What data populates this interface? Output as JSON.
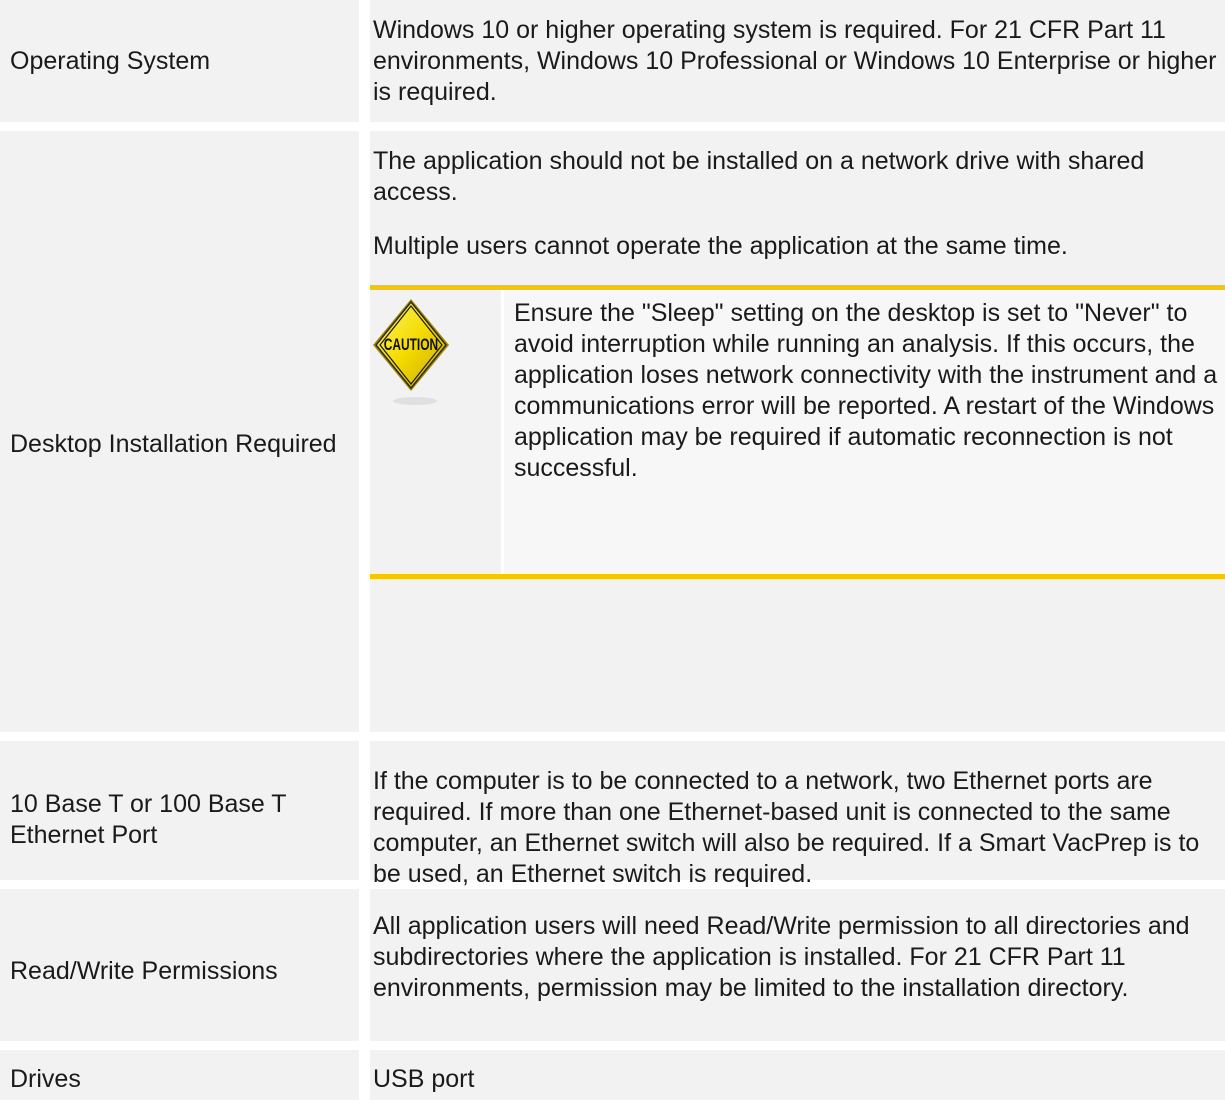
{
  "rows": [
    {
      "label": "Operating System",
      "value": "Windows 10 or higher operating system is required. For 21 CFR Part 11 environments, Windows 10 Professional or Windows 10 Enterprise or higher is required."
    },
    {
      "label": "Desktop Installation Required",
      "paragraphs": [
        "The application should not be installed on a network drive with shared access.",
        "Multiple users cannot operate the application at the same time."
      ],
      "caution": {
        "icon_text": "CAUTION",
        "icon": "caution-sign-icon",
        "text": "Ensure the \"Sleep\" setting on the desktop is set to \"Never\" to avoid interruption while running an analysis. If this occurs, the application loses network connectivity with the instrument and a communications error will be reported. A restart of the Windows application may be required if automatic reconnection is not successful."
      }
    },
    {
      "label": "10 Base T or 100 Base T Ethernet Port",
      "value": "If the computer is to be connected to a network, two Ethernet ports are required. If more than one Ethernet-based unit is connected to the same computer, an Ethernet switch will also be required. If a Smart VacPrep is to be used, an Ethernet switch is required."
    },
    {
      "label": "Read/Write Permissions",
      "value": "All application users will need Read/Write permission to all directories and subdirectories where the application is installed. For 21 CFR Part 11 environments, permission may be limited to the installation directory."
    },
    {
      "label": "Drives",
      "value": "USB port"
    }
  ],
  "colors": {
    "cell_bg": "#f2f2f2",
    "caution_rule": "#f7c600",
    "caution_sign_fill": "#f7e000"
  }
}
